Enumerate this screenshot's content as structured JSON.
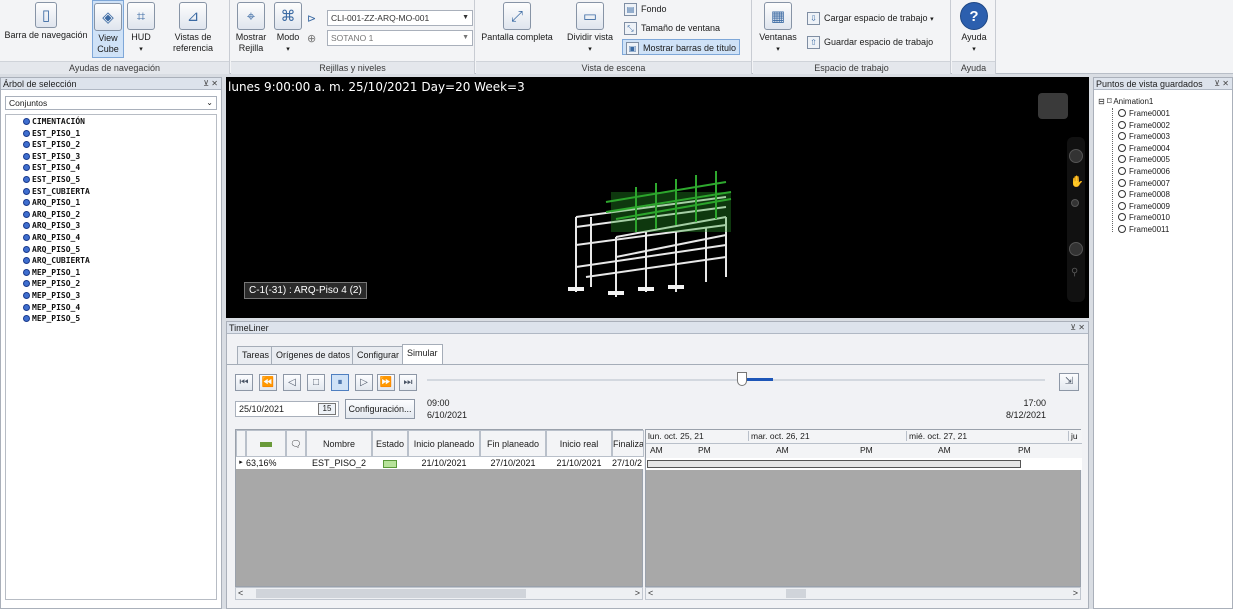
{
  "ribbon": {
    "nav_group_label": "Ayudas de navegación",
    "nav_bar_label": "Barra de navegación",
    "view_cube_label": "View Cube",
    "hud_label": "HUD",
    "ref_views_label": "Vistas de referencia",
    "grids_group_label": "Rejillas y niveles",
    "show_grid_label": "Mostrar Rejilla",
    "mode_label": "Modo",
    "grid_model": "CLI-001-ZZ-ARQ-MO-001",
    "grid_level": "SOTANO 1",
    "scene_group_label": "Vista de escena",
    "fullscreen_label": "Pantalla completa",
    "split_view_label": "Dividir vista",
    "background_label": "Fondo",
    "window_size_label": "Tamaño de ventana",
    "title_bars_label": "Mostrar barras de título",
    "workspace_group_label": "Espacio de trabajo",
    "windows_label": "Ventanas",
    "load_ws_label": "Cargar espacio de trabajo",
    "save_ws_label": "Guardar espacio de trabajo",
    "help_group_label": "Ayuda",
    "help_label": "Ayuda"
  },
  "selection_tree": {
    "title": "Árbol de selección",
    "dropdown": "Conjuntos",
    "items": [
      "CIMENTACIÓN",
      "EST_PISO_1",
      "EST_PISO_2",
      "EST_PISO_3",
      "EST_PISO_4",
      "EST_PISO_5",
      "EST_CUBIERTA",
      "ARQ_PISO_1",
      "ARQ_PISO_2",
      "ARQ_PISO_3",
      "ARQ_PISO_4",
      "ARQ_PISO_5",
      "ARQ_CUBIERTA",
      "MEP_PISO_1",
      "MEP_PISO_2",
      "MEP_PISO_3",
      "MEP_PISO_4",
      "MEP_PISO_5"
    ]
  },
  "viewport": {
    "overlay_text": "lunes 9:00:00 a. m. 25/10/2021 Day=20 Week=3",
    "tooltip": "C-1(-31) : ARQ-Piso 4 (2)"
  },
  "timeliner": {
    "title": "TimeLiner",
    "tabs": [
      "Tareas",
      "Orígenes de datos",
      "Configurar",
      "Simular"
    ],
    "date_value": "25/10/2021",
    "calendar_day": "15",
    "config_label": "Configuración...",
    "start_time": "09:00",
    "start_date": "6/10/2021",
    "end_time": "17:00",
    "end_date": "8/12/2021",
    "slider_position_pct": 51,
    "columns": [
      "Nombre",
      "Estado",
      "Inicio planeado",
      "Fin planeado",
      "Inicio real",
      "Finalizac"
    ],
    "row": {
      "progress": "63,16%",
      "name": "EST_PISO_2",
      "planned_start": "21/10/2021",
      "planned_end": "27/10/2021",
      "actual_start": "21/10/2021",
      "actual_end": "27/10/2"
    },
    "gantt_days": [
      "lun. oct. 25, 21",
      "mar. oct. 26, 21",
      "mié. oct. 27, 21",
      "ju"
    ],
    "gantt_halves": [
      "AM",
      "PM",
      "AM",
      "PM",
      "AM",
      "PM"
    ]
  },
  "saved_views": {
    "title": "Puntos de vista guardados",
    "root": "Animation1",
    "frames": [
      "Frame0001",
      "Frame0002",
      "Frame0003",
      "Frame0004",
      "Frame0005",
      "Frame0006",
      "Frame0007",
      "Frame0008",
      "Frame0009",
      "Frame0010",
      "Frame0011"
    ]
  }
}
